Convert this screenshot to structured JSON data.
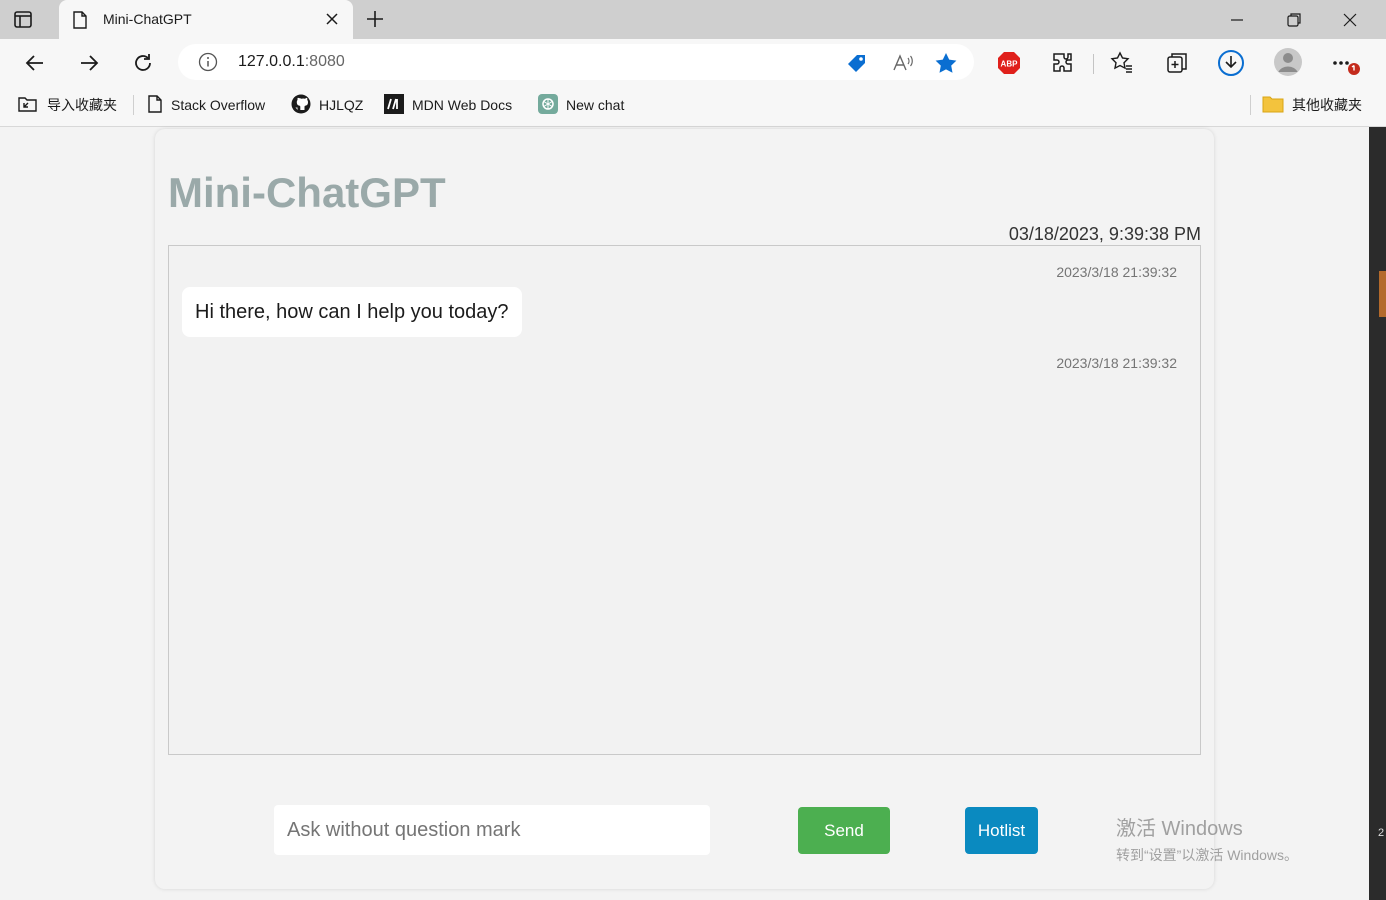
{
  "browser": {
    "tab_title": "Mini-ChatGPT",
    "url_host": "127.0.0.1",
    "url_port": ":8080"
  },
  "bookmarks": [
    {
      "label": "导入收藏夹",
      "icon": "import-favorites-icon"
    },
    {
      "label": "Stack Overflow",
      "icon": "page-icon"
    },
    {
      "label": "HJLQZ",
      "icon": "github-icon"
    },
    {
      "label": "MDN Web Docs",
      "icon": "mdn-icon"
    },
    {
      "label": "New chat",
      "icon": "openai-icon"
    }
  ],
  "other_favorites": "其他收藏夹",
  "page": {
    "title": "Mini-ChatGPT",
    "current_datetime": "03/18/2023, 9:39:38 PM",
    "messages": [
      {
        "timestamp": "2023/3/18 21:39:32",
        "text": "Hi there, how can I help you today?"
      },
      {
        "timestamp": "2023/3/18 21:39:32",
        "text": ""
      }
    ],
    "input_placeholder": "Ask without question mark",
    "send_label": "Send",
    "hotlist_label": "Hotlist"
  },
  "watermark": {
    "line1": "激活 Windows",
    "line2": "转到“设置”以激活 Windows。"
  },
  "colors": {
    "send_button": "#4caf50",
    "hotlist_button": "#0a8ac0",
    "title": "#9aa9a9"
  }
}
